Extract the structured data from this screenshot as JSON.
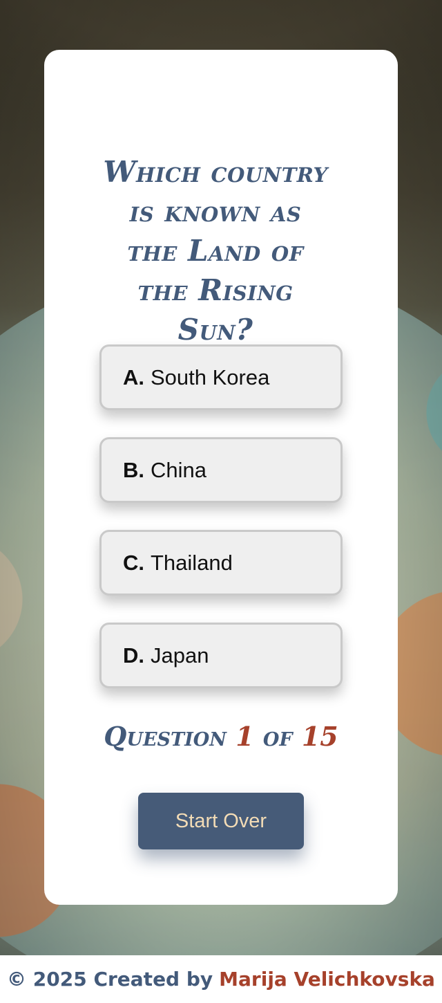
{
  "quiz": {
    "question": "Which country is known as the Land of the Rising Sun?",
    "answers": [
      {
        "letter": "A.",
        "text": "South Korea"
      },
      {
        "letter": "B.",
        "text": "China"
      },
      {
        "letter": "C.",
        "text": "Thailand"
      },
      {
        "letter": "D.",
        "text": "Japan"
      }
    ],
    "counter": {
      "prefix": "Question",
      "current": "1",
      "separator": "of",
      "total": "15"
    },
    "start_over_label": "Start Over"
  },
  "footer": {
    "text": "© 2025 Created by",
    "author": "Marija Velichkovska"
  },
  "colors": {
    "primary": "#435a7a",
    "accent": "#a6412b",
    "button": "#465b78",
    "button_text": "#f3dcb6"
  }
}
